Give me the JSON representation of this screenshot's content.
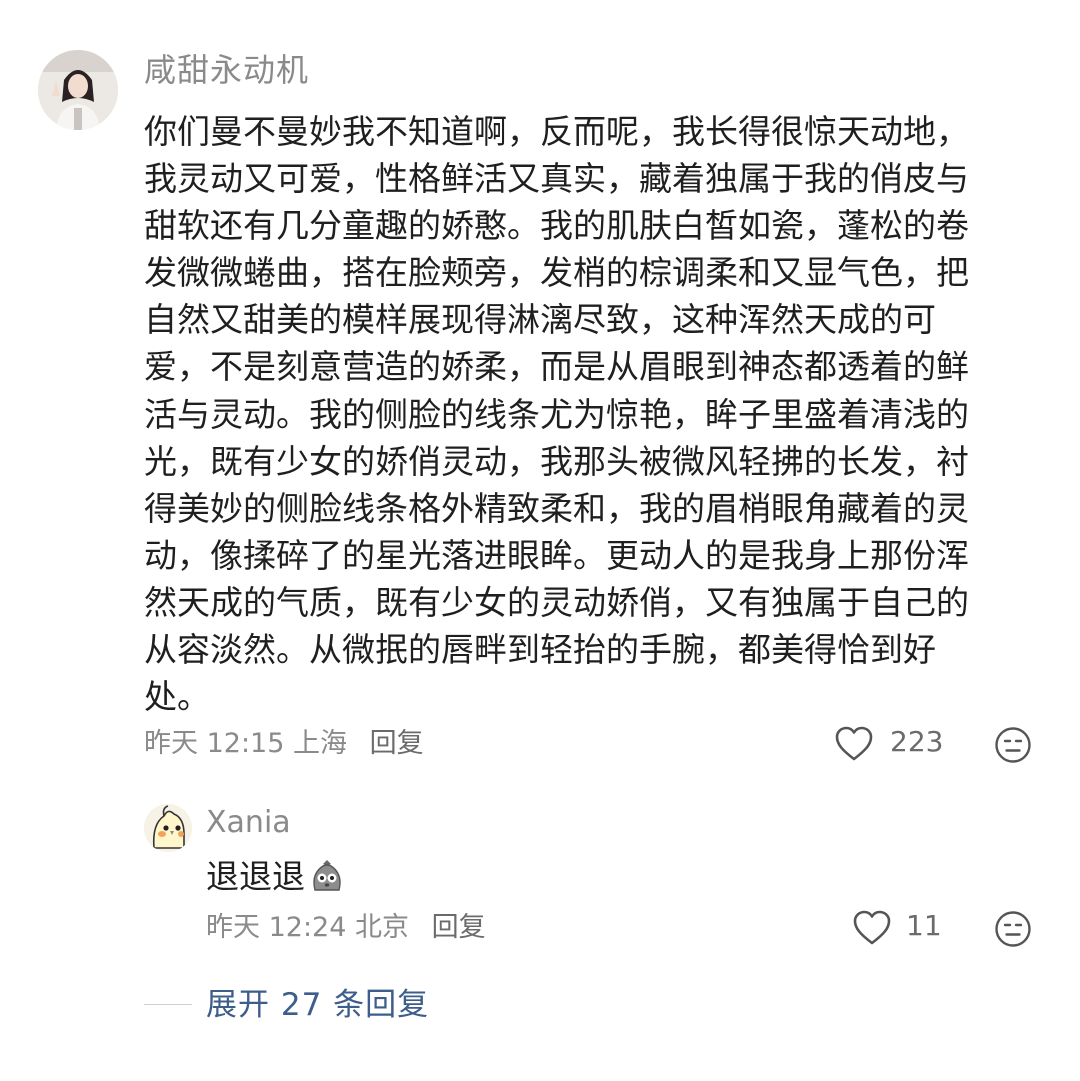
{
  "comment": {
    "username": "咸甜永动机",
    "avatar_icon": "user-photo-avatar",
    "body_lines": [
      "你们曼不曼妙我不知道啊，反而呢，我长得很惊天动地，",
      "我灵动又可爱，性格鲜活又真实，藏着独属于我的俏皮与",
      "甜软还有几分童趣的娇憨。我的肌肤白皙如瓷，蓬松的卷",
      "发微微蜷曲，搭在脸颊旁，发梢的棕调柔和又显气色，把",
      "自然又甜美的模样展现得淋漓尽致，这种浑然天成的可",
      "爱，不是刻意营造的娇柔，而是从眉眼到神态都透着的鲜",
      "活与灵动。我的侧脸的线条尤为惊艳，眸子里盛着清浅的",
      "光，既有少女的娇俏灵动，我那头被微风轻拂的长发，衬",
      "得美妙的侧脸线条格外精致柔和，我的眉梢眼角藏着的灵",
      "动，像揉碎了的星光落进眼眸。更动人的是我身上那份浑",
      "然天成的气质，既有少女的灵动娇俏，又有独属于自己的",
      "从容淡然。从微抿的唇畔到轻抬的手腕，都美得恰到好",
      "处。"
    ],
    "time": "昨天 12:15",
    "location": "上海",
    "reply_label": "回复",
    "like_count": "223",
    "like_icon": "heart-outline-icon",
    "dislike_icon": "neutral-face-icon"
  },
  "reply": {
    "username": "Xania",
    "avatar_icon": "cockatiel-bird-avatar",
    "text": "退退退",
    "emoji_icon": "grey-blob-emoji",
    "time": "昨天 12:24",
    "location": "北京",
    "reply_label": "回复",
    "like_count": "11",
    "like_icon": "heart-outline-icon",
    "dislike_icon": "neutral-face-icon"
  },
  "expand": {
    "label": "展开 27 条回复"
  },
  "colors": {
    "text_primary": "#1f1f1f",
    "text_secondary": "#8a8a8a",
    "link": "#3d5d8a",
    "icon": "#555555"
  }
}
